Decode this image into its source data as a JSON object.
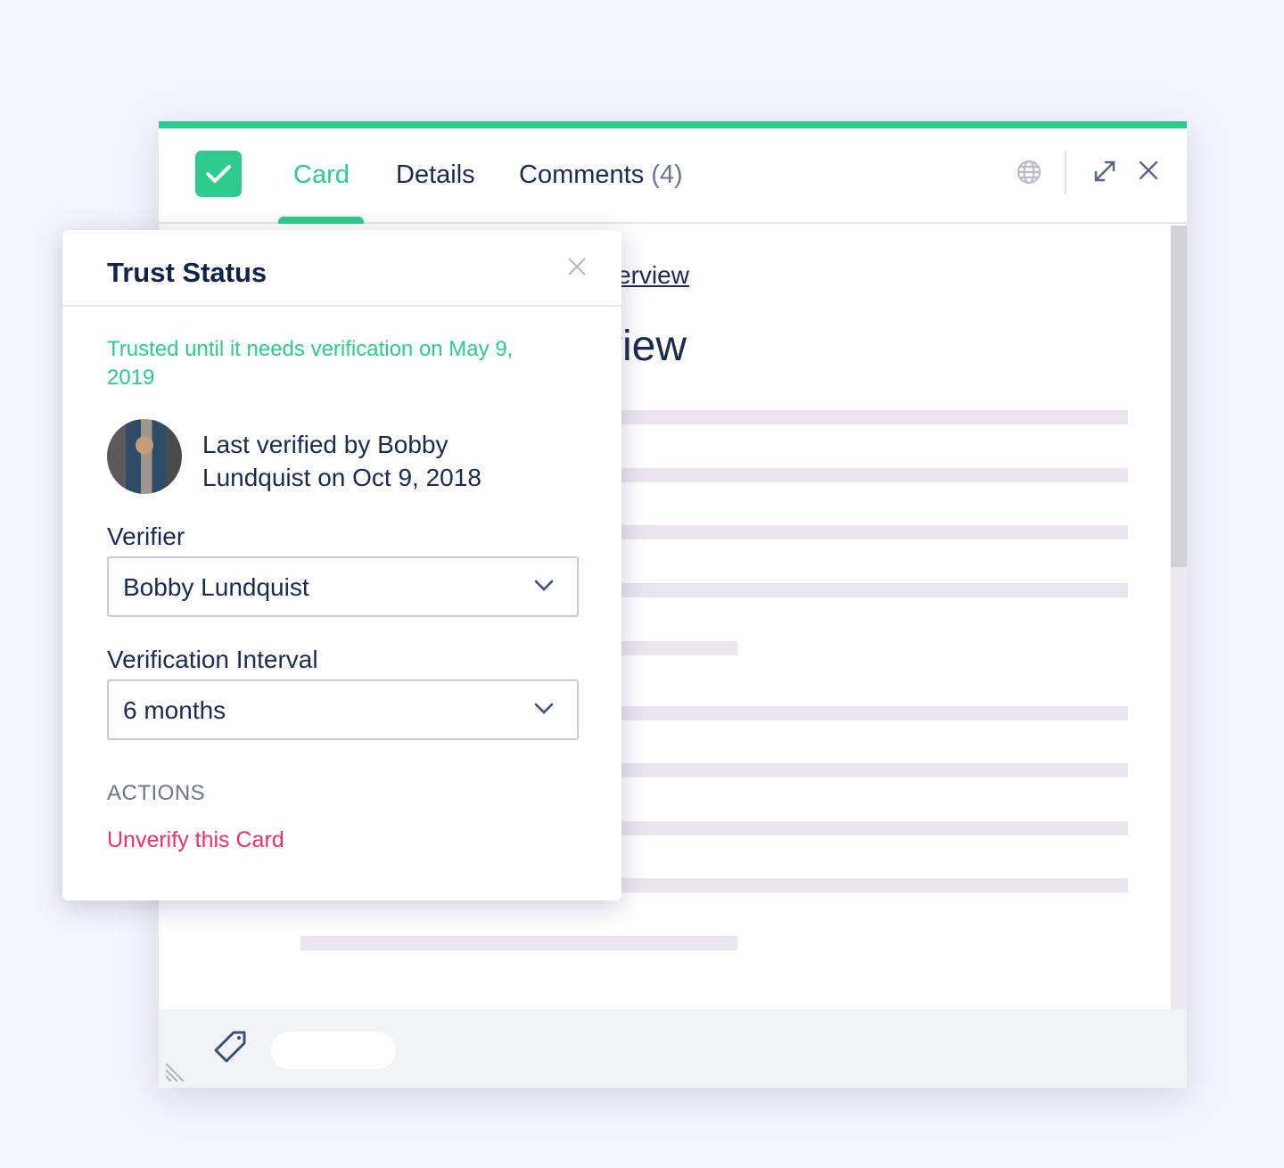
{
  "colors": {
    "accent": "#2ecb8e",
    "danger": "#e8336a",
    "text": "#1b2a4e"
  },
  "header": {
    "status_icon": "checkmark-icon",
    "tabs": [
      {
        "label": "Card",
        "active": true
      },
      {
        "label": "Details"
      },
      {
        "label": "Comments",
        "count": "(4)"
      }
    ],
    "icons": [
      "globe-icon",
      "expand-icon",
      "close-icon"
    ]
  },
  "content": {
    "link": "verview",
    "title": "rview"
  },
  "footer": {
    "icons": [
      "resize-handle-icon",
      "tag-icon"
    ]
  },
  "popup": {
    "title": "Trust Status",
    "trusted_text": "Trusted until it needs verification on May 9, 2019",
    "last_verified": "Last verified by Bobby Lundquist on Oct 9, 2018",
    "verifier_label": "Verifier",
    "verifier_value": "Bobby Lundquist",
    "interval_label": "Verification Interval",
    "interval_value": "6 months",
    "actions_label": "ACTIONS",
    "unverify_label": "Unverify this Card"
  }
}
